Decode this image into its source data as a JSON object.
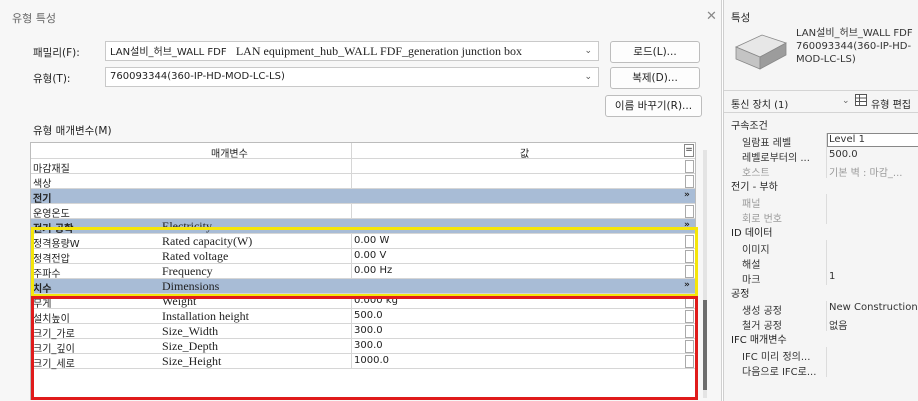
{
  "dialog": {
    "title": "유형 특성",
    "family_label": "패밀리(F):",
    "family_value": "LAN설비_허브_WALL FDF",
    "family_overlay": "LAN equipment_hub_WALL FDF_generation junction box",
    "type_label": "유형(T):",
    "type_value": "760093344(360-IP-HD-MOD-LC-LS)",
    "load_button": "로드(L)...",
    "duplicate_button": "복제(D)...",
    "rename_button": "이름 바꾸기(R)...",
    "params_caption": "유형 매개변수(M)",
    "col_param": "매개변수",
    "col_value": "값",
    "col_btn": "="
  },
  "rows": [
    {
      "kind": "param",
      "label": "마감재질",
      "value": ""
    },
    {
      "kind": "param",
      "label": "색상",
      "value": ""
    },
    {
      "kind": "group",
      "label": "전기"
    },
    {
      "kind": "param",
      "label": "운영온도",
      "value": ""
    },
    {
      "kind": "group",
      "label": "전기 공학",
      "english": "Electricity"
    },
    {
      "kind": "param",
      "label": "정격용량W",
      "english": "Rated capacity(W)",
      "value": "0.00 W"
    },
    {
      "kind": "param",
      "label": "정격전압",
      "english": "Rated voltage",
      "value": "0.00 V"
    },
    {
      "kind": "param",
      "label": "주파수",
      "english": "Frequency",
      "value": "0.00 Hz"
    },
    {
      "kind": "group",
      "label": "치수",
      "english": "Dimensions"
    },
    {
      "kind": "param",
      "label": "무게",
      "english": "Weight",
      "value": "0.000 kg"
    },
    {
      "kind": "param",
      "label": "설치높이",
      "english": "Installation height",
      "value": "500.0"
    },
    {
      "kind": "param",
      "label": "크기_가로",
      "english": "Size_Width",
      "value": "300.0"
    },
    {
      "kind": "param",
      "label": "크기_깊이",
      "english": "Size_Depth",
      "value": "300.0"
    },
    {
      "kind": "param",
      "label": "크기_세로",
      "english": "Size_Height",
      "value": "1000.0"
    }
  ],
  "group_chevron": "»",
  "properties": {
    "title": "특성",
    "type_name": "LAN설비_허브_WALL FDF 760093344(360-IP-HD-MOD-LC-LS)",
    "instance_selector": "통신 장치 (1)",
    "edit_type": "유형 편집",
    "sections": [
      {
        "title": "구속조건",
        "rows": [
          {
            "key": "일람표 레벨",
            "value": "Level 1",
            "editing": true
          },
          {
            "key": "레벨로부터의 ...",
            "value": "500.0"
          },
          {
            "key": "호스트",
            "value": "기본 벽 : 마감_...",
            "dim": true
          }
        ]
      },
      {
        "title": "전기 - 부하",
        "rows": [
          {
            "key": "패널",
            "value": "",
            "dim": true
          },
          {
            "key": "회로 번호",
            "value": "",
            "dim": true
          }
        ]
      },
      {
        "title": "ID 데이터",
        "rows": [
          {
            "key": "이미지",
            "value": ""
          },
          {
            "key": "해설",
            "value": ""
          },
          {
            "key": "마크",
            "value": "1"
          }
        ]
      },
      {
        "title": "공정",
        "rows": [
          {
            "key": "생성 공정",
            "value": "New Construction"
          },
          {
            "key": "철거 공정",
            "value": "없음"
          }
        ]
      },
      {
        "title": "IFC 매개변수",
        "rows": [
          {
            "key": "IFC 미리 정의...",
            "value": ""
          },
          {
            "key": "다음으로 IFC로...",
            "value": ""
          }
        ]
      }
    ]
  },
  "colors": {
    "group_bg": "#a8bcd6",
    "highlight_yellow": "#f5e60a",
    "highlight_red": "#e01b1b"
  },
  "icons": [
    "close-icon",
    "chevron-down-icon",
    "collapse-chevron-icon",
    "edit-type-icon",
    "family-thumbnail"
  ]
}
